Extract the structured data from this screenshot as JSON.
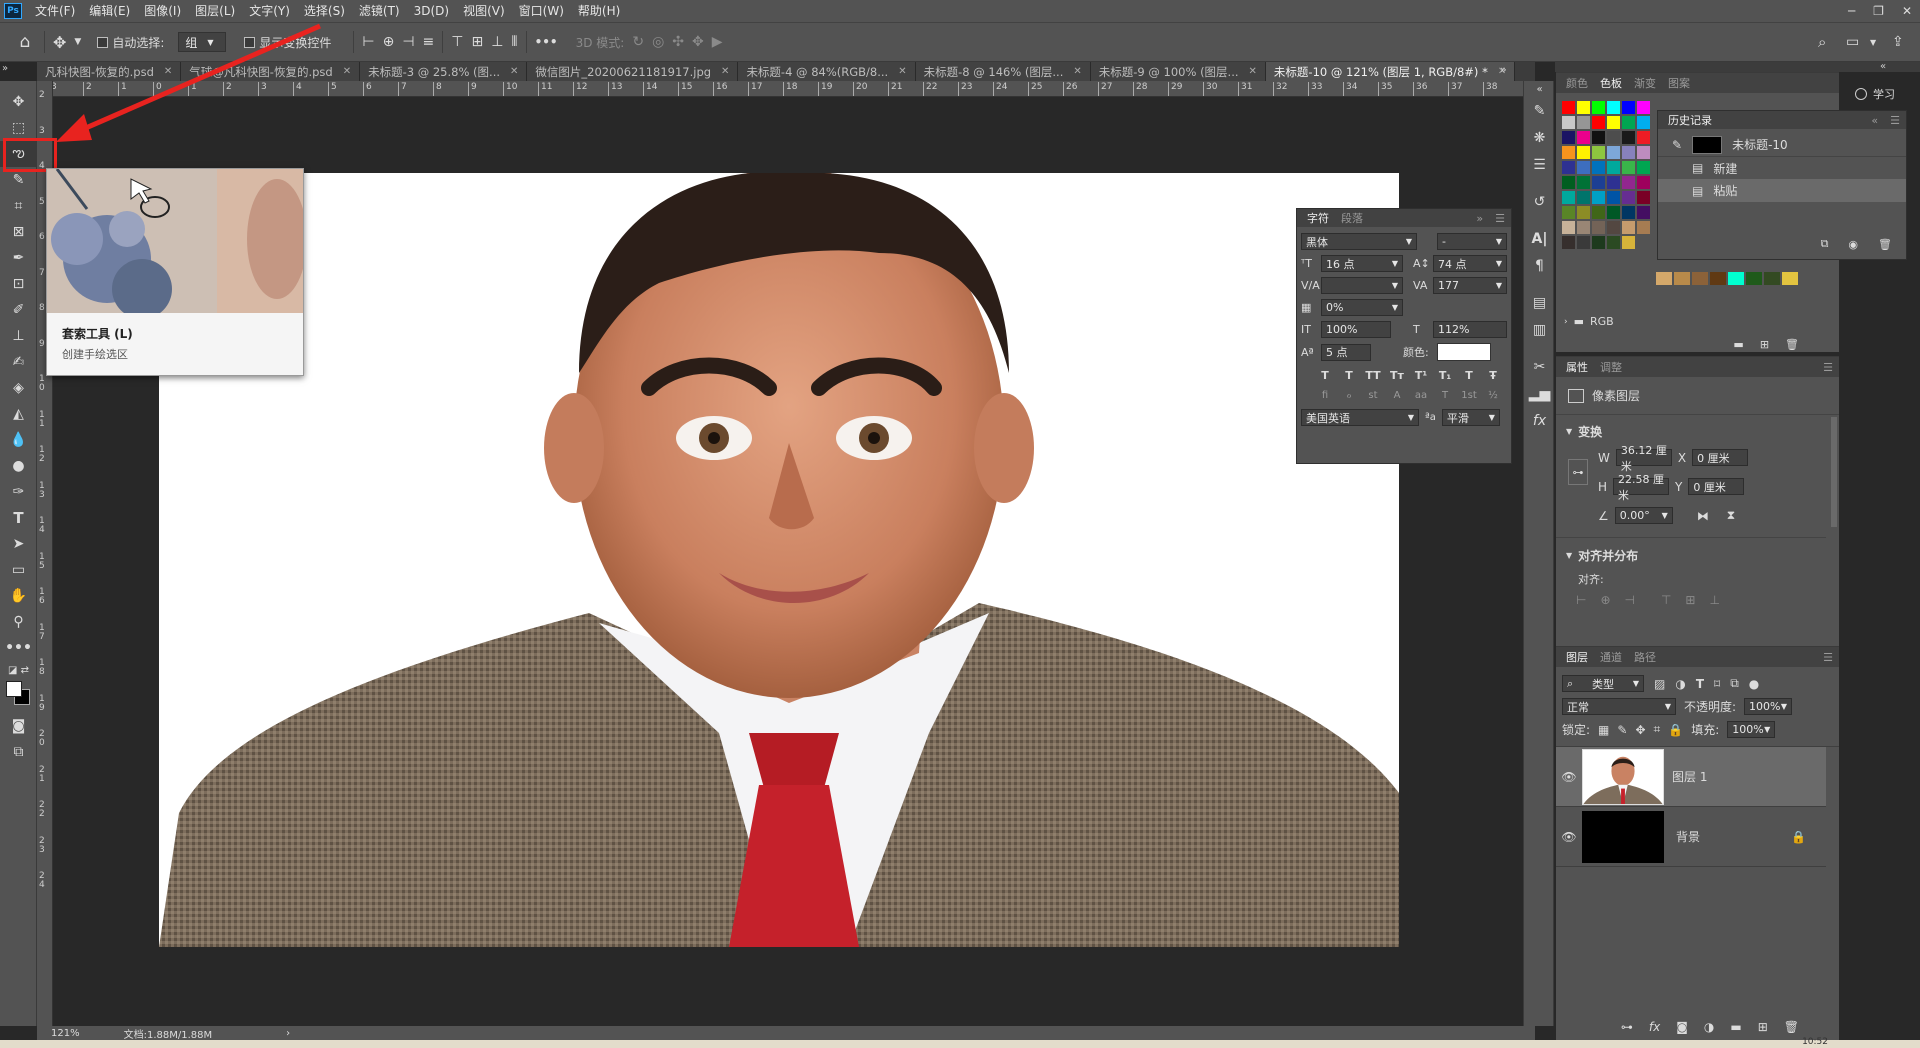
{
  "app": {
    "logo": "Ps"
  },
  "menu": [
    "文件(F)",
    "编辑(E)",
    "图像(I)",
    "图层(L)",
    "文字(Y)",
    "选择(S)",
    "滤镜(T)",
    "3D(D)",
    "视图(V)",
    "窗口(W)",
    "帮助(H)"
  ],
  "options": {
    "auto_select_label": "自动选择:",
    "auto_select_value": "组",
    "show_transform_label": "显示变换控件",
    "mode_3d_label": "3D 模式:",
    "more": "•••"
  },
  "tabs": [
    {
      "label": "凡科快图-恢复的.psd",
      "active": false
    },
    {
      "label": "气球@凡科快图-恢复的.psd",
      "active": false
    },
    {
      "label": "未标题-3 @ 25.8% (图...",
      "active": false
    },
    {
      "label": "微信图片_20200621181917.jpg",
      "active": false
    },
    {
      "label": "未标题-4 @ 84%(RGB/8...",
      "active": false
    },
    {
      "label": "未标题-8 @ 146% (图层...",
      "active": false
    },
    {
      "label": "未标题-9 @ 100% (图层...",
      "active": false
    },
    {
      "label": "未标题-10 @ 121% (图层 1, RGB/8#) *",
      "active": true
    }
  ],
  "ruler": {
    "h": [
      "3",
      "2",
      "1",
      "0",
      "1",
      "2",
      "3",
      "4",
      "5",
      "6",
      "7",
      "8",
      "9",
      "10",
      "11",
      "12",
      "13",
      "14",
      "15",
      "16",
      "17",
      "18",
      "19",
      "20",
      "21",
      "22",
      "23",
      "24",
      "25",
      "26",
      "27",
      "28",
      "29",
      "30",
      "31",
      "32",
      "33",
      "34",
      "35",
      "36",
      "37",
      "38"
    ],
    "v": [
      "2",
      "3",
      "4",
      "5",
      "6",
      "7",
      "8",
      "9",
      "1 0",
      "1 1",
      "1 2",
      "1 3",
      "1 4",
      "1 5",
      "1 6",
      "1 7",
      "1 8",
      "1 9",
      "2 0",
      "2 1",
      "2 2",
      "2 3",
      "2 4"
    ]
  },
  "tooltip": {
    "title": "套索工具 (L)",
    "desc": "创建手绘选区"
  },
  "status": {
    "zoom": "121%",
    "doc": "文档:1.88M/1.88M",
    "arrow": "›"
  },
  "char_panel": {
    "tabs": [
      "字符",
      "段落"
    ],
    "font_family": "黑体",
    "font_style": "-",
    "font_size": "16 点",
    "leading": "74 点",
    "kerning": "",
    "tracking": "177",
    "scale_pct": "0%",
    "vscale": "100%",
    "hscale": "112%",
    "baseline": "5 点",
    "color_label": "颜色:",
    "language": "美国英语",
    "aa_label": "ªa",
    "antialias": "平滑",
    "style_buttons": [
      "T",
      "T",
      "TT",
      "Tт",
      "T¹",
      "T₁",
      "T",
      "Ŧ"
    ],
    "opentype_buttons": [
      "fi",
      "ℴ",
      "st",
      "A",
      "aa",
      "T",
      "1st",
      "½"
    ]
  },
  "swatches_panel": {
    "tabs": [
      "颜色",
      "色板",
      "渐变",
      "图案"
    ],
    "group_label": "RGB",
    "colors": [
      "#ff0000",
      "#ffff00",
      "#00ff00",
      "#00ffff",
      "#0000ff",
      "#ff00ff",
      "#c8c8c8",
      "#969696",
      "#ff0000",
      "#ffff00",
      "#00a651",
      "#00aeef",
      "#1b1464",
      "#ec008c",
      "#111111",
      "#4d4d4d",
      "#1a1a1a",
      "#ed1c24",
      "#f7941d",
      "#fff200",
      "#8dc63f",
      "#7da7d9",
      "#8781bd",
      "#bd8cbf",
      "#2e3192",
      "#3d6ebf",
      "#0072bc",
      "#00a99d",
      "#39b54a",
      "#00a651",
      "#005e20",
      "#007236",
      "#1c3f94",
      "#2e3192",
      "#92278f",
      "#9e005d",
      "#00a99d",
      "#00746b",
      "#00a0c6",
      "#0054a6",
      "#662d91",
      "#7a0026",
      "#598527",
      "#8c8c25",
      "#406618",
      "#005826",
      "#003663",
      "#440e62",
      "#c7b299",
      "#998675",
      "#736357",
      "#534741",
      "#c69c6d",
      "#a67c52",
      "#362f2d",
      "#3a3a3a",
      "#1d3a1d",
      "#2b4a22",
      "#d7b33a"
    ],
    "extra_colors": [
      "#d4a86a",
      "#b88a4a",
      "#8c6239",
      "#603913",
      "#00ffd0",
      "#1f5a1a",
      "#334a22",
      "#e3c440"
    ]
  },
  "history_panel": {
    "title": "历史记录",
    "snapshot": "未标题-10",
    "items": [
      "新建",
      "粘贴"
    ]
  },
  "properties_panel": {
    "tabs": [
      "属性",
      "调整"
    ],
    "layer_type": "像素图层",
    "transform_label": "变换",
    "w_label": "W",
    "w": "36.12 厘米",
    "x_label": "X",
    "x": "0 厘米",
    "h_label": "H",
    "h": "22.58 厘米",
    "y_label": "Y",
    "y": "0 厘米",
    "angle": "0.00°",
    "align_label": "对齐并分布",
    "align_sub": "对齐:"
  },
  "layers_panel": {
    "tabs": [
      "图层",
      "通道",
      "路径"
    ],
    "filter": "类型",
    "blend": "正常",
    "opacity_label": "不透明度:",
    "opacity": "100%",
    "lock_label": "锁定:",
    "fill_label": "填充:",
    "fill": "100%",
    "layers": [
      {
        "name": "图层 1",
        "selected": true
      },
      {
        "name": "背景",
        "selected": false
      }
    ]
  },
  "learn_label": "学习",
  "taskbar_time": "10:52"
}
